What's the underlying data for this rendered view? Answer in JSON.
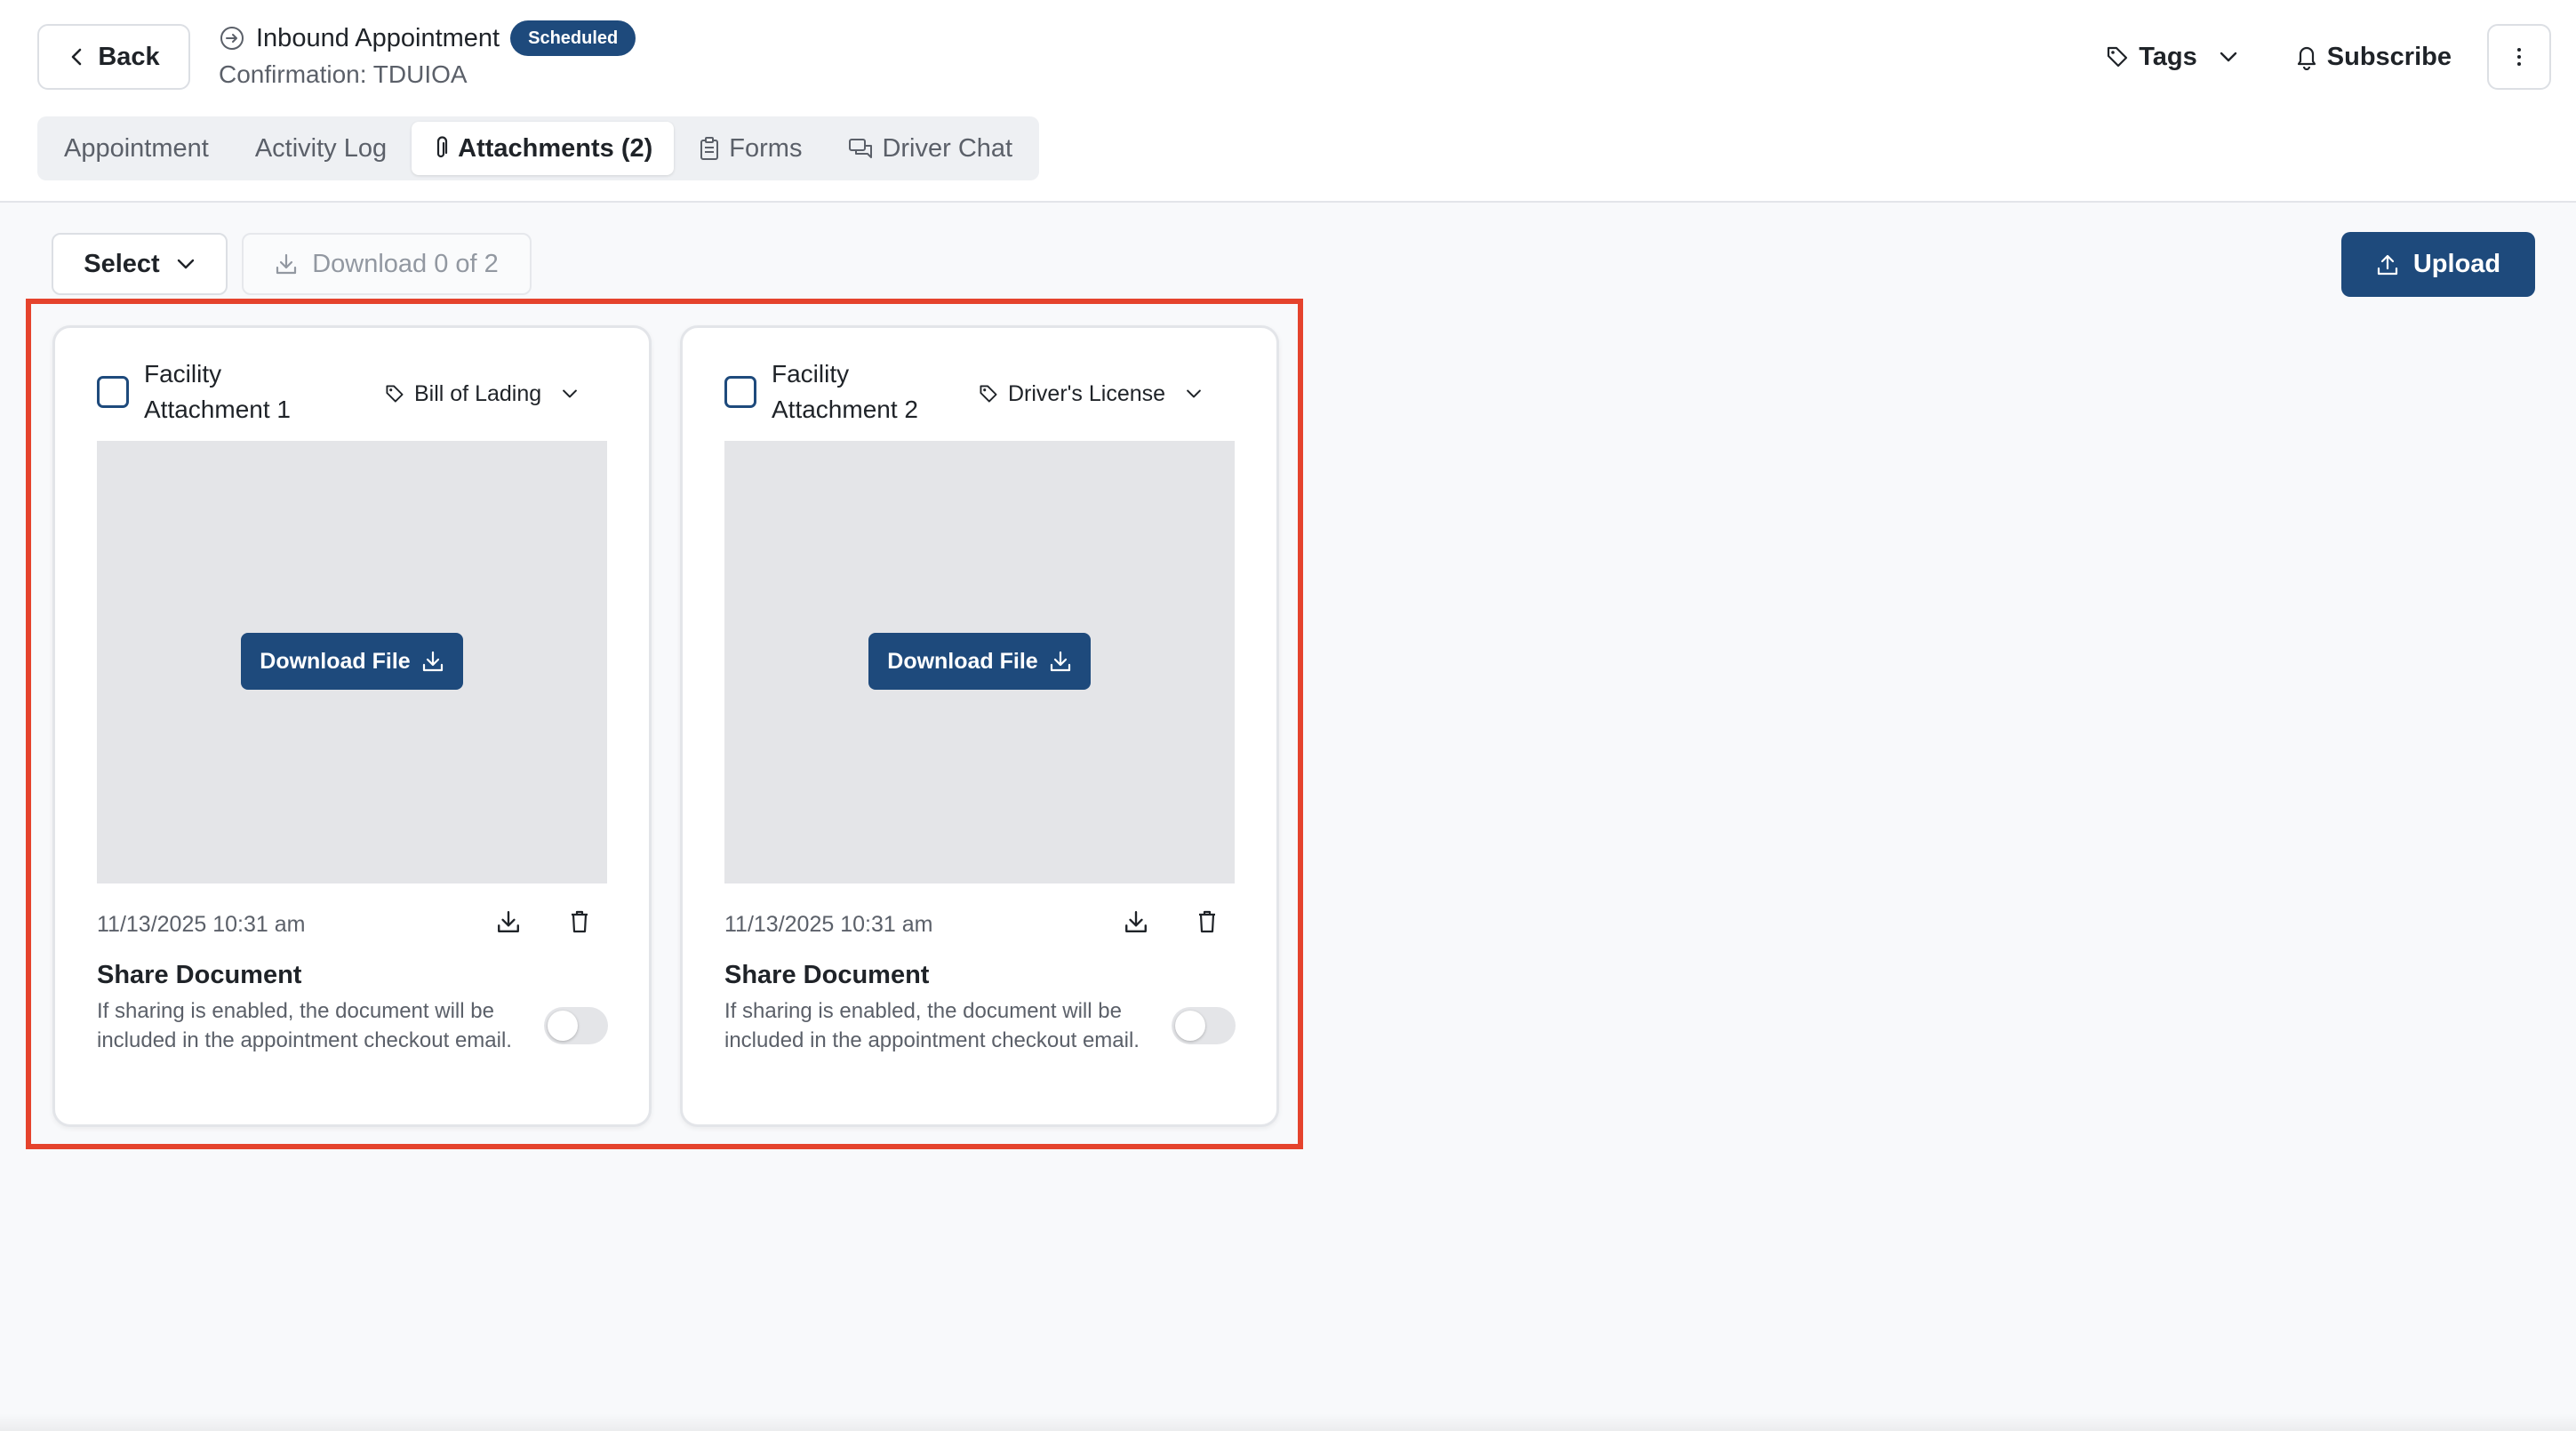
{
  "header": {
    "back_label": "Back",
    "title": "Inbound Appointment",
    "status_badge": "Scheduled",
    "confirmation": "Confirmation: TDUIOA",
    "tags_label": "Tags",
    "subscribe_label": "Subscribe"
  },
  "tabs": [
    {
      "label": "Appointment",
      "active": false
    },
    {
      "label": "Activity Log",
      "active": false
    },
    {
      "label": "Attachments (2)",
      "active": true
    },
    {
      "label": "Forms",
      "active": false
    },
    {
      "label": "Driver Chat",
      "active": false
    }
  ],
  "toolbar": {
    "select_label": "Select",
    "download_label": "Download 0 of 2",
    "upload_label": "Upload"
  },
  "attachments": [
    {
      "title": "Facility Attachment 1",
      "document_type": "Bill of Lading",
      "download_file_label": "Download File",
      "timestamp": "11/13/2025 10:31 am",
      "share_title": "Share Document",
      "share_description": "If sharing is enabled, the document will be included in the appointment checkout email.",
      "shared": false,
      "selected": false
    },
    {
      "title": "Facility Attachment 2",
      "document_type": "Driver's License",
      "download_file_label": "Download File",
      "timestamp": "11/13/2025 10:31 am",
      "share_title": "Share Document",
      "share_description": "If sharing is enabled, the document will be included in the appointment checkout email.",
      "shared": false,
      "selected": false
    }
  ],
  "colors": {
    "primary": "#1e4a7c",
    "highlight_border": "#e5432d",
    "preview_bg": "#e4e5e8"
  }
}
